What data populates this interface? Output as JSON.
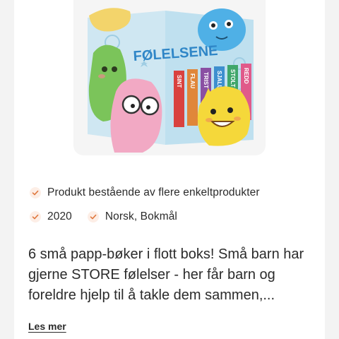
{
  "product": {
    "image_alt_title": "FØLELSENE",
    "spines": [
      "SINT",
      "FLAU",
      "TRIST",
      "SJALU",
      "STOLT",
      "REDD"
    ],
    "spine_colors": [
      "#d9423f",
      "#e0863a",
      "#8a4fa3",
      "#3d8fcf",
      "#3fa66b",
      "#e05a8a"
    ]
  },
  "meta": {
    "type_label": "Produkt bestående av flere enkeltprodukter",
    "year": "2020",
    "language": "Norsk, Bokmål"
  },
  "description": {
    "text": "6 små papp-bøker i flott boks! Små barn har gjerne STORE følelser - her får barn og foreldre hjelp til å takle dem sammen,...",
    "read_more_label": "Les mer"
  },
  "colors": {
    "check_bg": "#fdeee6",
    "check_mark": "#e0793f",
    "text": "#2b2b2b"
  }
}
